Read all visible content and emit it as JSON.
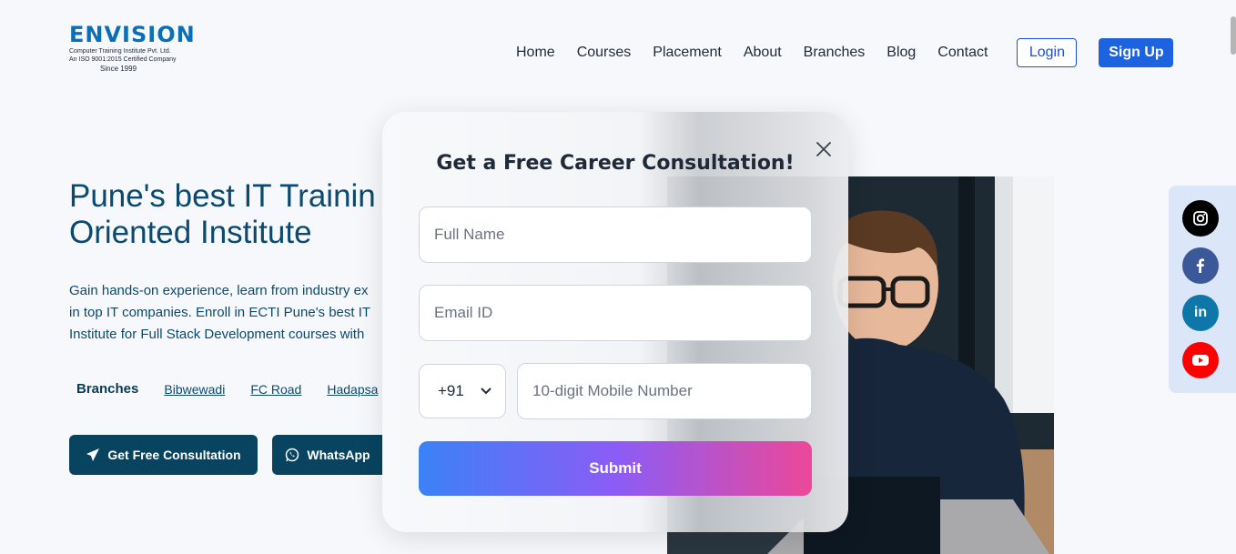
{
  "brand": {
    "wordmark": "ENVISION",
    "tagline": "Computer Training Institute Pvt. Ltd.",
    "iso": "An ISO 9001:2015 Certified Company",
    "since": "Since 1999"
  },
  "nav": {
    "links": [
      "Home",
      "Courses",
      "Placement",
      "About",
      "Branches",
      "Blog",
      "Contact"
    ],
    "login_label": "Login",
    "signup_label": "Sign Up"
  },
  "hero": {
    "title_line1": "Pune's best IT Trainin",
    "title_line2": "Oriented Institute",
    "desc_line1": "Gain hands-on experience, learn from industry ex",
    "desc_line2": "in top IT companies. Enroll in ECTI Pune's best IT",
    "desc_line3": "Institute for Full Stack Development courses with",
    "branches_label": "Branches",
    "branches": [
      "Bibwewadi",
      "FC Road",
      "Hadapsa"
    ],
    "cta_primary": "Get Free Consultation",
    "cta_whatsapp": "WhatsApp"
  },
  "modal": {
    "title": "Get a Free Career Consultation!",
    "name_placeholder": "Full Name",
    "email_placeholder": "Email ID",
    "country_code": "+91",
    "mobile_placeholder": "10-digit Mobile Number",
    "submit_label": "Submit"
  },
  "social": {
    "icons": [
      "instagram-icon",
      "facebook-icon",
      "linkedin-icon",
      "youtube-icon"
    ],
    "colors": [
      "#000000",
      "#3b5998",
      "#0e76a8",
      "#ff0000"
    ],
    "labels": [
      "in"
    ]
  }
}
